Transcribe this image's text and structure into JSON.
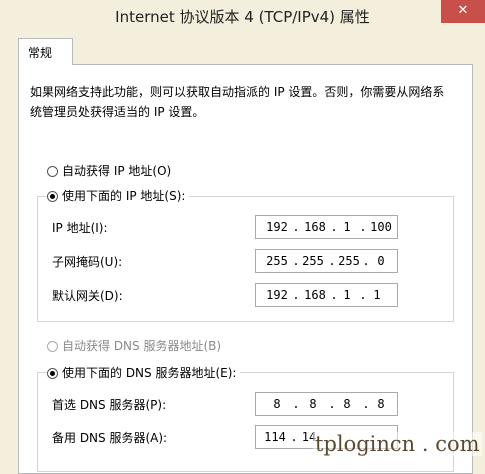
{
  "window": {
    "title": "Internet 协议版本 4 (TCP/IPv4) 属性",
    "close_label": "✕"
  },
  "tab": {
    "label": "常规"
  },
  "description": "如果网络支持此功能，则可以获取自动指派的 IP 设置。否则，你需要从网络系统管理员处获得适当的 IP 设置。",
  "ip_section": {
    "auto_label": "自动获得 IP 地址(O)",
    "manual_label": "使用下面的 IP 地址(S):",
    "selected": "manual",
    "fields": [
      {
        "label": "IP 地址(I):",
        "octets": [
          "192",
          "168",
          "1",
          "100"
        ]
      },
      {
        "label": "子网掩码(U):",
        "octets": [
          "255",
          "255",
          "255",
          "0"
        ]
      },
      {
        "label": "默认网关(D):",
        "octets": [
          "192",
          "168",
          "1",
          "1"
        ]
      }
    ]
  },
  "dns_section": {
    "auto_label": "自动获得 DNS 服务器地址(B)",
    "manual_label": "使用下面的 DNS 服务器地址(E):",
    "selected": "manual",
    "fields": [
      {
        "label": "首选 DNS 服务器(P):",
        "octets": [
          "8",
          "8",
          "8",
          "8"
        ]
      },
      {
        "label": "备用 DNS 服务器(A):",
        "octets": [
          "114",
          "14",
          "",
          ""
        ]
      }
    ]
  },
  "watermark": "tplogincn . com"
}
